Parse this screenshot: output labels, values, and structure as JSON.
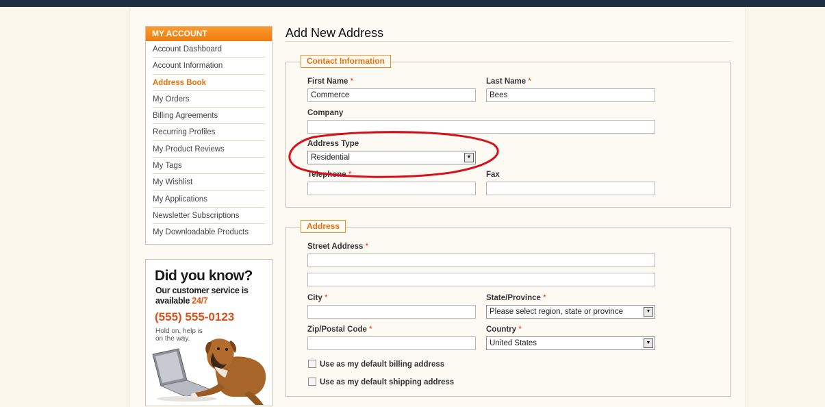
{
  "sidebar": {
    "heading": "MY ACCOUNT",
    "items": [
      {
        "label": "Account Dashboard"
      },
      {
        "label": "Account Information"
      },
      {
        "label": "Address Book",
        "active": true
      },
      {
        "label": "My Orders"
      },
      {
        "label": "Billing Agreements"
      },
      {
        "label": "Recurring Profiles"
      },
      {
        "label": "My Product Reviews"
      },
      {
        "label": "My Tags"
      },
      {
        "label": "My Wishlist"
      },
      {
        "label": "My Applications"
      },
      {
        "label": "Newsletter Subscriptions"
      },
      {
        "label": "My Downloadable Products"
      }
    ]
  },
  "promo": {
    "title": "Did you know?",
    "line1": "Our customer service is",
    "line2_prefix": "available ",
    "line2_highlight": "24/7",
    "phone": "(555) 555-0123",
    "note1": "Hold on, help is",
    "note2": "on the way."
  },
  "page": {
    "title": "Add New Address"
  },
  "contact": {
    "legend": "Contact Information",
    "first_name": {
      "label": "First Name",
      "value": "Commerce"
    },
    "last_name": {
      "label": "Last Name",
      "value": "Bees"
    },
    "company": {
      "label": "Company",
      "value": ""
    },
    "address_type": {
      "label": "Address Type",
      "value": "Residential"
    },
    "telephone": {
      "label": "Telephone",
      "value": ""
    },
    "fax": {
      "label": "Fax",
      "value": ""
    }
  },
  "address": {
    "legend": "Address",
    "street": {
      "label": "Street Address",
      "value": "",
      "value2": ""
    },
    "city": {
      "label": "City",
      "value": ""
    },
    "state": {
      "label": "State/Province",
      "value": "Please select region, state or province"
    },
    "zip": {
      "label": "Zip/Postal Code",
      "value": ""
    },
    "country": {
      "label": "Country",
      "value": "United States"
    },
    "default_billing": "Use as my default billing address",
    "default_shipping": "Use as my default shipping address"
  },
  "colors": {
    "accent": "#f08a1c",
    "header_bar": "#1b2d3e",
    "required": "#eb340a",
    "annotation": "#d7111b"
  }
}
